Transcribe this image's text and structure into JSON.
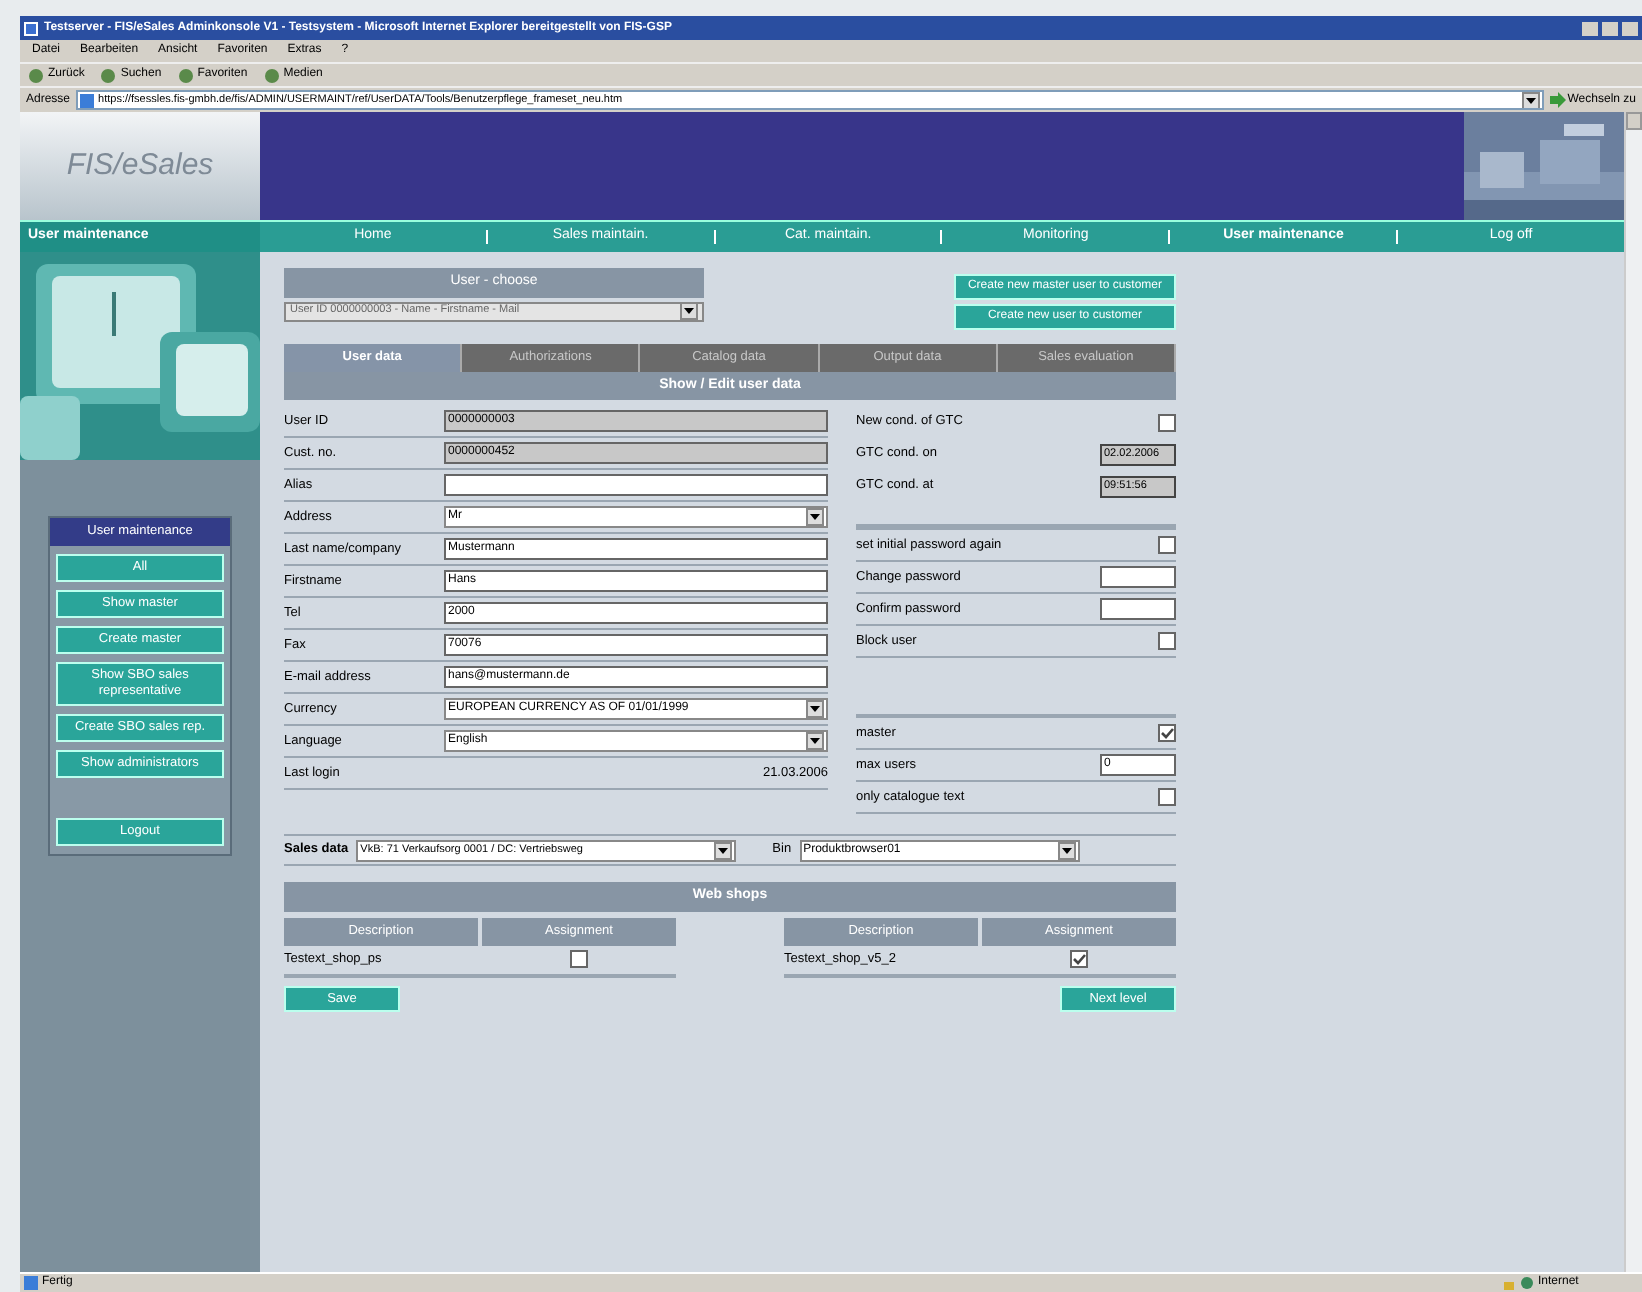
{
  "window": {
    "title": "Testserver - FIS/eSales Adminkonsole V1 - Testsystem - Microsoft Internet Explorer bereitgestellt von FIS-GSP"
  },
  "menu_bar": [
    "Datei",
    "Bearbeiten",
    "Ansicht",
    "Favoriten",
    "Extras",
    "?"
  ],
  "toolbar": [
    "Zurück",
    "Suchen",
    "Favoriten",
    "Medien"
  ],
  "address_bar": {
    "label": "Adresse",
    "url": "https://fsessles.fis-gmbh.de/fis/ADMIN/USERMAINT/ref/UserDATA/Tools/Benutzerpflege_frameset_neu.htm",
    "go": "Wechseln zu"
  },
  "header": {
    "logo": "FIS/eSales"
  },
  "nav": {
    "section": "User maintenance",
    "items": [
      {
        "label": "Home",
        "selected": false
      },
      {
        "label": "Sales maintain.",
        "selected": false
      },
      {
        "label": "Cat. maintain.",
        "selected": false
      },
      {
        "label": "Monitoring",
        "selected": false
      },
      {
        "label": "User maintenance",
        "selected": true
      },
      {
        "label": "Log off",
        "selected": false
      }
    ]
  },
  "sidebar": {
    "title": "User maintenance",
    "buttons": [
      "All",
      "Show master",
      "Create master",
      "Show SBO sales representative",
      "Create SBO sales rep.",
      "Show administrators",
      "Logout"
    ]
  },
  "user_choose": {
    "title": "User - choose",
    "select": "User ID 0000000003 - Name - Firstname - Mail"
  },
  "actions": [
    "Create new master user to customer",
    "Create new user to customer"
  ],
  "tabs": [
    {
      "label": "User data",
      "selected": true
    },
    {
      "label": "Authorizations",
      "selected": false
    },
    {
      "label": "Catalog data",
      "selected": false
    },
    {
      "label": "Output data",
      "selected": false
    },
    {
      "label": "Sales evaluation",
      "selected": false
    }
  ],
  "panel_title": "Show / Edit user data",
  "fields": [
    {
      "label": "User ID",
      "kind": "readonly",
      "value": "0000000003"
    },
    {
      "label": "Cust. no.",
      "kind": "readonly",
      "value": "0000000452"
    },
    {
      "label": "Alias",
      "kind": "input"
    },
    {
      "label": "Address",
      "kind": "select",
      "value": "Mr"
    },
    {
      "label": "Last name/company",
      "kind": "input",
      "value": "Mustermann"
    },
    {
      "label": "Firstname",
      "kind": "input",
      "value": "Hans"
    },
    {
      "label": "Tel",
      "kind": "input",
      "value": "2000"
    },
    {
      "label": "Fax",
      "kind": "input",
      "value": "70076"
    },
    {
      "label": "E-mail address",
      "kind": "input",
      "value": "hans@mustermann.de"
    },
    {
      "label": "Currency",
      "kind": "select",
      "value": "EUROPEAN CURRENCY AS OF 01/01/1999"
    },
    {
      "label": "Language",
      "kind": "select",
      "value": "English"
    },
    {
      "label": "Last login",
      "kind": "text",
      "value": "21.03.2006"
    }
  ],
  "right_fields": [
    {
      "label": "New cond. of GTC",
      "kind": "checkbox",
      "checked": false
    },
    {
      "label": "GTC cond. on",
      "kind": "readonly",
      "value": "02.02.2006"
    },
    {
      "label": "GTC cond. at",
      "kind": "readonly",
      "value": "09:51:56"
    },
    {
      "kind": "divider"
    },
    {
      "label": "set initial password again",
      "kind": "checkbox",
      "checked": false
    },
    {
      "label": "Change password",
      "kind": "input"
    },
    {
      "label": "Confirm password",
      "kind": "input"
    },
    {
      "label": "Block user",
      "kind": "checkbox",
      "checked": false
    },
    {
      "kind": "spacer"
    },
    {
      "label": "master",
      "kind": "checkbox",
      "checked": true
    },
    {
      "label": "max users",
      "kind": "input",
      "value": "0"
    },
    {
      "label": "only catalogue text",
      "kind": "checkbox",
      "checked": false
    }
  ],
  "sales_data": {
    "label": "Sales data",
    "value": "VkB: 71 Verkaufsorg 0001 / DC: Vertriebsweg"
  },
  "bin": {
    "label": "Bin",
    "value": "Produktbrowser01"
  },
  "web_shops": {
    "title": "Web shops",
    "left": {
      "columns": [
        "Description",
        "Assignment"
      ],
      "name": "Testext_shop_ps",
      "checked": false
    },
    "right": {
      "columns": [
        "Description",
        "Assignment"
      ],
      "name": "Testext_shop_v5_2",
      "checked": true
    }
  },
  "buttons": [
    "Save",
    "Next level"
  ],
  "status_bar": {
    "text": "Fertig",
    "zone": "Internet"
  }
}
